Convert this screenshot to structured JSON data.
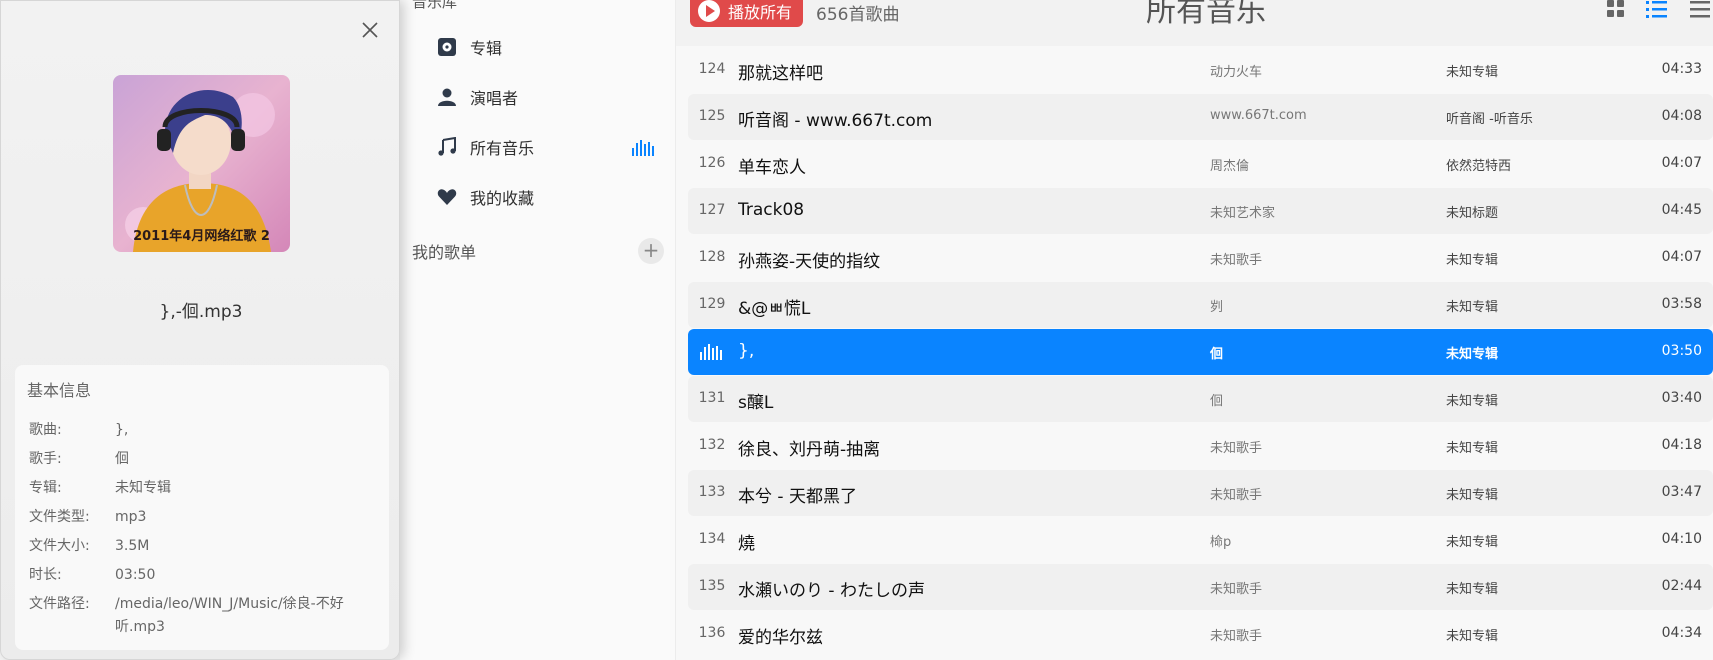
{
  "sidebar": {
    "section_title": "音乐库",
    "items": [
      {
        "label": "专辑",
        "icon": "album-icon"
      },
      {
        "label": "演唱者",
        "icon": "person-icon"
      },
      {
        "label": "所有音乐",
        "icon": "music-note-icon"
      },
      {
        "label": "我的收藏",
        "icon": "heart-icon"
      }
    ],
    "playlists_label": "我的歌单",
    "add_label": "+"
  },
  "toolbar": {
    "play_all_label": "播放所有",
    "song_count": "656首歌曲",
    "title": "所有音乐"
  },
  "songs": [
    {
      "num": "124",
      "title": "那就这样吧",
      "artist": "动力火车",
      "album": "未知专辑",
      "duration": "04:33"
    },
    {
      "num": "125",
      "title": "听音阁 - www.667t.com",
      "artist": "www.667t.com",
      "album": "听音阁 -听音乐",
      "duration": "04:08"
    },
    {
      "num": "126",
      "title": "单车恋人",
      "artist": "周杰倫",
      "album": "依然范特西",
      "duration": "04:07"
    },
    {
      "num": "127",
      "title": "Track08",
      "artist": "未知艺术家",
      "album": "未知标题",
      "duration": "04:45"
    },
    {
      "num": "128",
      "title": "孙燕姿-天使的指纹",
      "artist": "未知歌手",
      "album": "未知专辑",
      "duration": "04:07"
    },
    {
      "num": "129",
      "title": "&@ㅃ慌L",
      "artist": "刿",
      "album": "未知专辑",
      "duration": "03:58"
    },
    {
      "num": "",
      "title": "},",
      "artist": "佪",
      "album": "未知专辑",
      "duration": "03:50"
    },
    {
      "num": "131",
      "title": "s醸L",
      "artist": "佪",
      "album": "未知专辑",
      "duration": "03:40"
    },
    {
      "num": "132",
      "title": "徐良、刘丹萌-抽离",
      "artist": "未知歌手",
      "album": "未知专辑",
      "duration": "04:18"
    },
    {
      "num": "133",
      "title": "本兮 - 天都黑了",
      "artist": "未知歌手",
      "album": "未知专辑",
      "duration": "03:47"
    },
    {
      "num": "134",
      "title": "燒",
      "artist": "椧p",
      "album": "未知专辑",
      "duration": "04:10"
    },
    {
      "num": "135",
      "title": "水瀬いのり - わたしの声",
      "artist": "未知歌手",
      "album": "未知专辑",
      "duration": "02:44"
    },
    {
      "num": "136",
      "title": "爱的华尔兹",
      "artist": "未知歌手",
      "album": "未知专辑",
      "duration": "04:34"
    }
  ],
  "info": {
    "cover_caption": "2011年4月网络红歌 2",
    "file_name": "},-佪.mp3",
    "section_title": "基本信息",
    "fields": [
      {
        "key": "歌曲:",
        "value": "},"
      },
      {
        "key": "歌手:",
        "value": "佪"
      },
      {
        "key": "专辑:",
        "value": "未知专辑"
      },
      {
        "key": "文件类型:",
        "value": "mp3"
      },
      {
        "key": "文件大小:",
        "value": "3.5M"
      },
      {
        "key": "时长:",
        "value": "03:50"
      },
      {
        "key": "文件路径:",
        "value": "/media/leo/WIN_J/Music/徐良-不好听.mp3"
      }
    ]
  },
  "colors": {
    "accent": "#0a84ff",
    "play_all": "#e04a4a"
  }
}
